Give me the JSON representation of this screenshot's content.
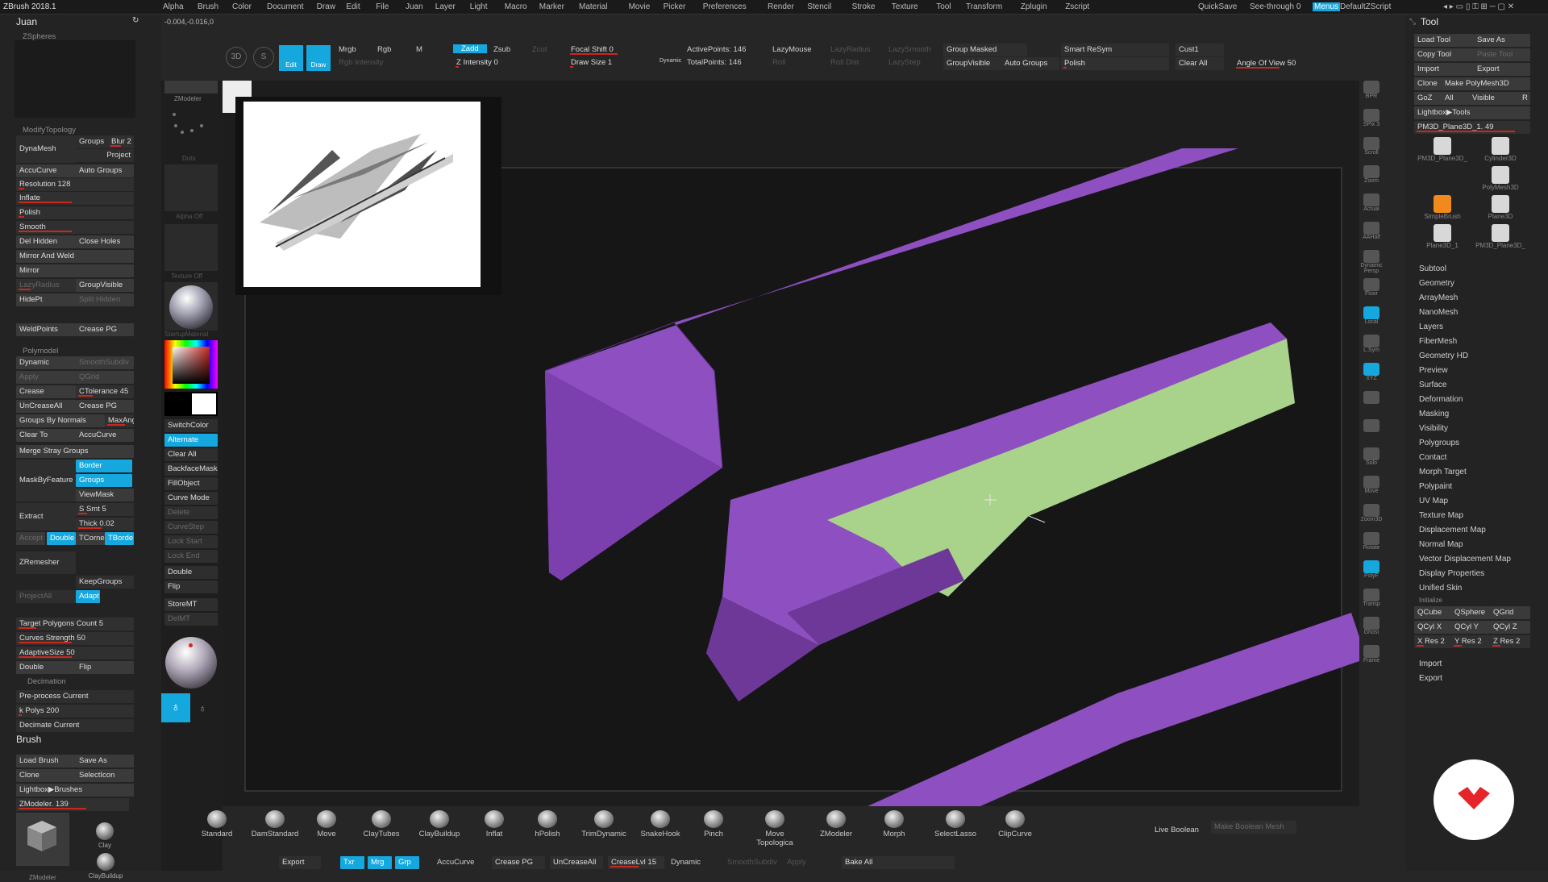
{
  "app": {
    "title": "ZBrush 2018.1",
    "document": "Juan",
    "coords": "-0.004,-0.016,0"
  },
  "menus": [
    "Alpha",
    "Brush",
    "Color",
    "Document",
    "Draw",
    "Edit",
    "File",
    "Juan",
    "Layer",
    "Light",
    "Macro",
    "Marker",
    "Material",
    "Movie",
    "Picker",
    "Preferences",
    "Render",
    "Stencil",
    "Stroke",
    "Texture",
    "Tool",
    "Transform",
    "Zplugin",
    "Zscript"
  ],
  "topright": {
    "quicksave": "QuickSave",
    "seethrough": "See-through 0",
    "menus": "Menus",
    "script": "DefaultZScript"
  },
  "toolbar": {
    "edit": "Edit",
    "draw": "Draw",
    "mrgb": "Mrgb",
    "rgb": "Rgb",
    "m": "M",
    "zadd": "Zadd",
    "zsub": "Zsub",
    "zcut": "Zcut",
    "rgb_intensity": "Rgb Intensity",
    "z_intensity": "Z Intensity 0",
    "focal_shift": "Focal Shift 0",
    "draw_size": "Draw Size 1",
    "dynamic": "Dynamic",
    "active_points": "ActivePoints: 146",
    "total_points": "TotalPoints: 146",
    "lazymouse": "LazyMouse",
    "lazyradius": "LazyRadius",
    "lazystep": "LazyStep",
    "lazysmooth": "LazySmooth",
    "roll": "Roll",
    "rolldist": "Roll Dist",
    "group_masked": "Group Masked",
    "group_visible": "GroupVisible",
    "auto_groups": "Auto Groups",
    "smart_resym": "Smart ReSym",
    "polish": "Polish",
    "cust1": "Cust1",
    "clear_all": "Clear All",
    "angle_of_view": "Angle Of View 50"
  },
  "left": {
    "zspheres": "ZSpheres",
    "modify_topology": "ModifyTopology",
    "dynamesh": "DynaMesh",
    "groups": "Groups",
    "blur": "Blur 2",
    "project": "Project",
    "accucurve": "AccuCurve",
    "auto_groups": "Auto Groups",
    "resolution": "Resolution 128",
    "inflate": "Inflate",
    "polish": "Polish",
    "smooth": "Smooth",
    "del_hidden": "Del Hidden",
    "close_holes": "Close Holes",
    "mirror_weld": "Mirror And Weld",
    "mirror": "Mirror",
    "lazyradius": "LazyRadius",
    "groupvisible": "GroupVisible",
    "hidept": "HidePt",
    "split_hidden": "Split Hidden",
    "weldpoints": "WeldPoints",
    "crease_pg": "Crease PG",
    "polymodel": "Polymodel",
    "dynamic": "Dynamic",
    "smooth_subdiv": "SmoothSubdiv",
    "apply": "Apply",
    "qgrid": "QGrid",
    "crease": "Crease",
    "ctolerance": "CTolerance 45",
    "uncrease_all": "UnCreaseAll",
    "crease_pg2": "Crease PG",
    "groups_by_normals": "Groups By Normals",
    "maxangle": "MaxAng",
    "clear_to": "Clear To",
    "accucurve2": "AccuCurve",
    "merge_stray": "Merge Stray Groups",
    "mask_by_feature": "MaskByFeature",
    "border": "Border",
    "groups2": "Groups",
    "viewmask": "ViewMask",
    "extract": "Extract",
    "s_smt": "S Smt 5",
    "thick": "Thick 0.02",
    "accept": "Accept",
    "double": "Double",
    "tcorne": "TCorne",
    "tborder": "TBorde",
    "zremesher": "ZRemesher",
    "keepgroups": "KeepGroups",
    "projectall": "ProjectAll",
    "adapt": "Adapt",
    "target_polys": "Target Polygons Count 5",
    "curves_strength": "Curves Strength 50",
    "adaptive_size": "AdaptiveSize 50",
    "double2": "Double",
    "flip": "Flip",
    "decimation": "Decimation",
    "preprocess": "Pre-process Current",
    "k_polys": "k Polys 200",
    "decimate_current": "Decimate Current",
    "brush": "Brush",
    "load_brush": "Load Brush",
    "save_as": "Save As",
    "clone": "Clone",
    "selecticon": "SelectIcon",
    "lightbox_brushes": "Lightbox▶Brushes",
    "zmodeler": "ZModeler. 139",
    "r": "R",
    "clay": "Clay",
    "claybuildup": "ClayBuildup",
    "zmodeler_thumb": "ZModeler"
  },
  "shelf": {
    "zmodeler": "ZModeler",
    "dots": "Dots",
    "alpha_off": "Alpha Off",
    "texture_off": "Texture Off",
    "startup_material": "StartupMaterial",
    "switchcolor": "SwitchColor",
    "alternate": "Alternate",
    "clear_all": "Clear All",
    "backfacemask": "BackfaceMask",
    "fillobject": "FillObject",
    "curve_mode": "Curve Mode",
    "delete": "Delete",
    "curvestep": "CurveStep",
    "lock_start": "Lock Start",
    "lock_end": "Lock End",
    "double": "Double",
    "flip": "Flip",
    "storemt": "StoreMT",
    "delmt": "DelMT",
    "colors": {
      "main": "#c9281f",
      "secondary": "#ffffff"
    }
  },
  "right": {
    "tool": "Tool",
    "load_tool": "Load Tool",
    "save_as": "Save As",
    "copy_tool": "Copy Tool",
    "paste_tool": "Paste Tool",
    "import": "Import",
    "export": "Export",
    "clone": "Clone",
    "make_polymesh": "Make PolyMesh3D",
    "goz": "GoZ",
    "all": "All",
    "visible": "Visible",
    "r": "R",
    "lightbox_tools": "Lightbox▶Tools",
    "current_tool": "PM3D_Plane3D_1. 49",
    "thumbs": [
      "PM3D_Plane3D_",
      "Cylinder3D",
      "PolyMesh3D",
      "SimpleBrush",
      "Plane3D",
      "Plane3D_1",
      "PM3D_Plane3D_"
    ],
    "subpalettes": [
      "Subtool",
      "Geometry",
      "ArrayMesh",
      "NanoMesh",
      "Layers",
      "FiberMesh",
      "Geometry HD",
      "Preview",
      "Surface",
      "Deformation",
      "Masking",
      "Visibility",
      "Polygroups",
      "Contact",
      "Morph Target",
      "Polypaint",
      "UV Map",
      "Texture Map",
      "Displacement Map",
      "Normal Map",
      "Vector Displacement Map",
      "Display Properties",
      "Unified Skin"
    ],
    "initialize": "Initialize",
    "qcube": "QCube",
    "qsphere": "QSphere",
    "qgrid": "QGrid",
    "qcylx": "QCyl X",
    "qcyly": "QCyl Y",
    "qcylz": "QCyl Z",
    "xres": "X Res 2",
    "yres": "Y Res 2",
    "zres": "Z Res 2",
    "import2": "Import",
    "export2": "Export"
  },
  "viewtools": [
    "BPR",
    "SPix 3",
    "Scroll",
    "Zoom",
    "Actual",
    "AAHalf",
    "Dynamic Persp",
    "Floor",
    "Local",
    "L.Sym",
    "XYZ",
    "",
    "",
    "Solo",
    "Move",
    "Zoom3D",
    "Rotate",
    "PolyF",
    "Transp",
    "Ghost",
    "Frame"
  ],
  "bottom": {
    "brushes": [
      "Standard",
      "DamStandard",
      "Move",
      "ClayTubes",
      "ClayBuildup",
      "Inflat",
      "hPolish",
      "TrimDynamic",
      "SnakeHook",
      "Pinch",
      "Move Topologica",
      "ZModeler",
      "Morph",
      "SelectLasso",
      "ClipCurve"
    ],
    "live_boolean": "Live Boolean",
    "make_boolean": "Make Boolean Mesh",
    "export": "Export",
    "txr": "Txr",
    "mrg": "Mrg",
    "grp": "Grp",
    "accucurve": "AccuCurve",
    "crease_pg": "Crease PG",
    "uncrease_all": "UnCreaseAll",
    "creaselvl": "CreaseLvl 15",
    "dynamic": "Dynamic",
    "smoothsubdiv": "SmoothSubdiv",
    "apply": "Apply",
    "bake_all": "Bake All"
  },
  "colors": {
    "accent": "#14a8df",
    "slider": "#c9281f",
    "mesh": "#8e4fc0",
    "mask": "#a9d28a",
    "logo": "#e6252a"
  }
}
